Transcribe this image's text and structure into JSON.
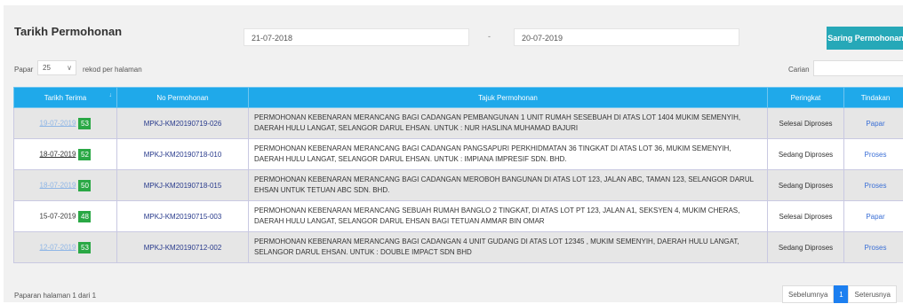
{
  "header": {
    "title": "Tarikh Permohonan",
    "date_from": "21-07-2018",
    "date_separator": "-",
    "date_to": "20-07-2019",
    "filter_button": "Saring Permohonan"
  },
  "controls": {
    "show_label": "Papar",
    "page_size": "25",
    "per_page_label": "rekod per halaman",
    "search_label": "Carian",
    "search_value": ""
  },
  "table": {
    "headers": [
      "Tarikh Terima",
      "No Permohonan",
      "Tajuk Permohonan",
      "Peringkat",
      "Tindakan"
    ],
    "rows": [
      {
        "date": "19-07-2019",
        "badge": "53",
        "number": "MPKJ-KM20190719-026",
        "title": "PERMOHONAN KEBENARAN MERANCANG BAGI CADANGAN PEMBANGUNAN 1 UNIT RUMAH SESEBUAH DI ATAS LOT 1404 MUKIM SEMENYIH, DAERAH HULU LANGAT, SELANGOR DARUL EHSAN. UNTUK : NUR HASLINA MUHAMAD BAJURI",
        "status": "Selesai Diproses",
        "action": "Papar"
      },
      {
        "date": "18-07-2019",
        "badge": "52",
        "number": "MPKJ-KM20190718-010",
        "title": "PERMOHONAN KEBENARAN MERANCANG BAGI CADANGAN PANGSAPURI PERKHIDMATAN 36 TINGKAT DI ATAS LOT 36, MUKIM SEMENYIH, DAERAH HULU LANGAT, SELANGOR DARUL EHSAN. UNTUK : IMPIANA IMPRESIF SDN. BHD.",
        "status": "Sedang Diproses",
        "action": "Proses"
      },
      {
        "date": "18-07-2019",
        "badge": "50",
        "number": "MPKJ-KM20190718-015",
        "title": "PERMOHONAN KEBENARAN MERANCANG BAGI CADANGAN MEROBOH BANGUNAN DI ATAS LOT 123, JALAN ABC, TAMAN 123, SELANGOR DARUL EHSAN UNTUK TETUAN ABC SDN. BHD.",
        "status": "Sedang Diproses",
        "action": "Proses"
      },
      {
        "date": "15-07-2019",
        "badge": "48",
        "number": "MPKJ-KM20190715-003",
        "title": "PERMOHONAN KEBENARAN MERANCANG SEBUAH RUMAH BANGLO 2 TINGKAT, DI ATAS LOT PT 123, JALAN A1, SEKSYEN 4, MUKIM CHERAS, DAERAH HULU LANGAT, SELANGOR DARUL EHSAN BAGI TETUAN AMMAR BIN OMAR",
        "status": "Selesai Diproses",
        "action": "Papar"
      },
      {
        "date": "12-07-2019",
        "badge": "53",
        "number": "MPKJ-KM20190712-002",
        "title": "PERMOHONAN KEBENARAN MERANCANG BAGI CADANGAN 4 UNIT GUDANG DI ATAS LOT 12345 , MUKIM SEMENYIH, DAERAH HULU LANGAT, SELANGOR DARUL EHSAN. UNTUK : DOUBLE IMPACT SDN BHD",
        "status": "Sedang Diproses",
        "action": "Proses"
      }
    ]
  },
  "footer": {
    "page_info": "Paparan halaman 1 dari 1",
    "prev_label": "Sebelumnya",
    "current_page": "1",
    "next_label": "Seterusnya"
  },
  "colors": {
    "header_blue": "#1fa9ea",
    "filter_teal": "#26a8b8",
    "badge_green": "#2aa845",
    "link_blue": "#3a6fd6"
  }
}
